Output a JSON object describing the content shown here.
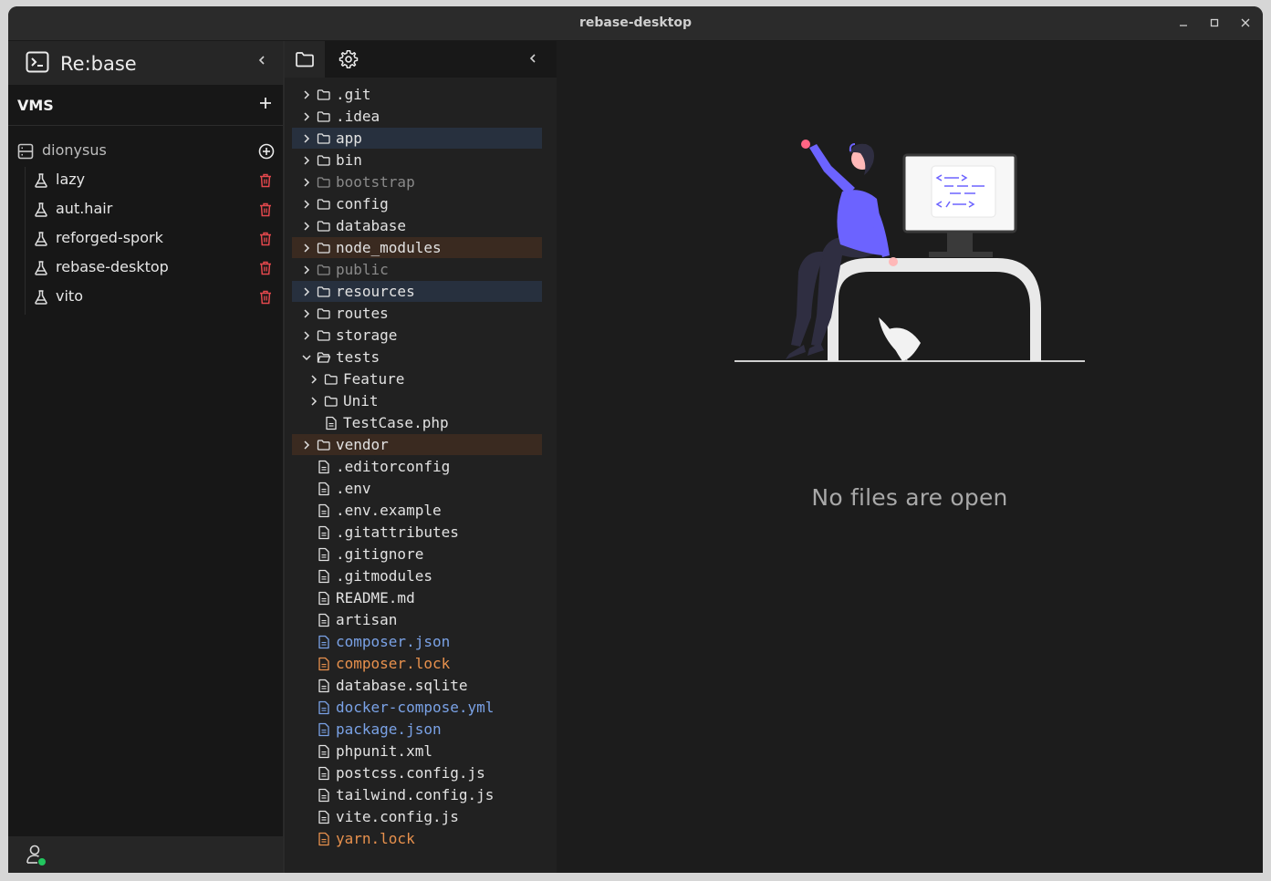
{
  "window": {
    "title": "rebase-desktop"
  },
  "app": {
    "name": "Re:base"
  },
  "vms": {
    "label": "VMS"
  },
  "server": {
    "name": "dionysus"
  },
  "vm_items": [
    "lazy",
    "aut.hair",
    "reforged-spork",
    "rebase-desktop",
    "vito"
  ],
  "files": [
    {
      "name": ".git",
      "type": "folder"
    },
    {
      "name": ".idea",
      "type": "folder"
    },
    {
      "name": "app",
      "type": "folder",
      "highlight": "blue"
    },
    {
      "name": "bin",
      "type": "folder"
    },
    {
      "name": "bootstrap",
      "type": "folder",
      "style": "dim"
    },
    {
      "name": "config",
      "type": "folder"
    },
    {
      "name": "database",
      "type": "folder"
    },
    {
      "name": "node_modules",
      "type": "folder",
      "highlight": "brown"
    },
    {
      "name": "public",
      "type": "folder",
      "style": "dim"
    },
    {
      "name": "resources",
      "type": "folder",
      "highlight": "blue"
    },
    {
      "name": "routes",
      "type": "folder"
    },
    {
      "name": "storage",
      "type": "folder"
    },
    {
      "name": "tests",
      "type": "folder",
      "open": true
    },
    {
      "name": "Feature",
      "type": "folder",
      "depth": 1
    },
    {
      "name": "Unit",
      "type": "folder",
      "depth": 1
    },
    {
      "name": "TestCase.php",
      "type": "file",
      "depth": 1
    },
    {
      "name": "vendor",
      "type": "folder",
      "highlight": "brown"
    },
    {
      "name": ".editorconfig",
      "type": "file"
    },
    {
      "name": ".env",
      "type": "file"
    },
    {
      "name": ".env.example",
      "type": "file"
    },
    {
      "name": ".gitattributes",
      "type": "file"
    },
    {
      "name": ".gitignore",
      "type": "file"
    },
    {
      "name": ".gitmodules",
      "type": "file"
    },
    {
      "name": "README.md",
      "type": "file"
    },
    {
      "name": "artisan",
      "type": "file"
    },
    {
      "name": "composer.json",
      "type": "file",
      "style": "blue"
    },
    {
      "name": "composer.lock",
      "type": "file",
      "style": "orange"
    },
    {
      "name": "database.sqlite",
      "type": "file"
    },
    {
      "name": "docker-compose.yml",
      "type": "file",
      "style": "blue"
    },
    {
      "name": "package.json",
      "type": "file",
      "style": "blue"
    },
    {
      "name": "phpunit.xml",
      "type": "file"
    },
    {
      "name": "postcss.config.js",
      "type": "file"
    },
    {
      "name": "tailwind.config.js",
      "type": "file"
    },
    {
      "name": "vite.config.js",
      "type": "file"
    },
    {
      "name": "yarn.lock",
      "type": "file",
      "style": "orange"
    }
  ],
  "main": {
    "empty_message": "No files are open"
  },
  "colors": {
    "accent": "#6c63ff",
    "delete": "#e5484d",
    "online": "#22c55e",
    "blue_highlight": "#27303e",
    "brown_highlight": "#3a2a20"
  }
}
